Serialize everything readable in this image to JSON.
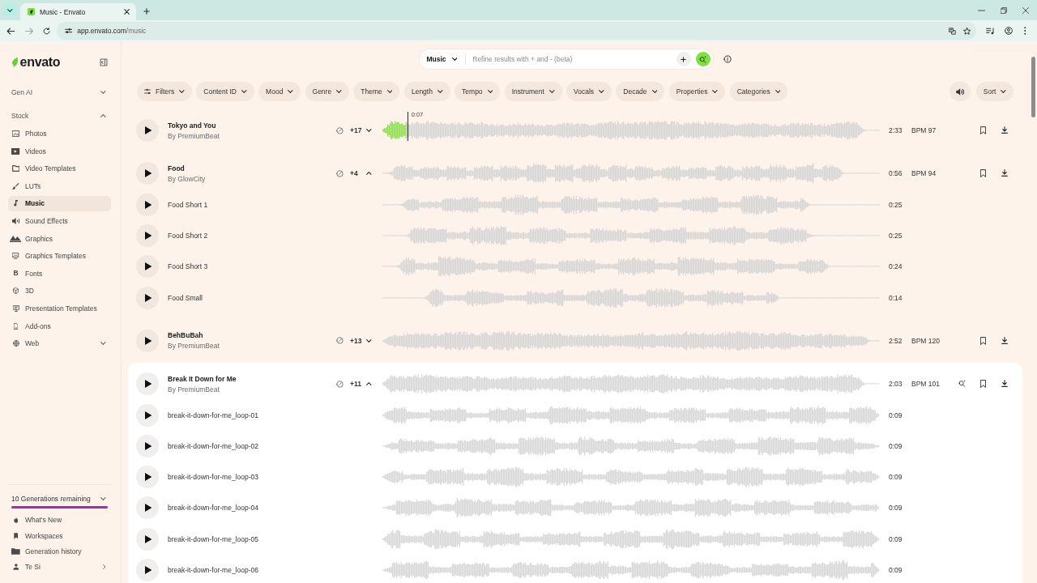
{
  "browser": {
    "tabs": [
      {
        "title": "Music - Envato",
        "selected": true
      }
    ],
    "url": {
      "host": "app.envato.com",
      "path": "/music"
    }
  },
  "sidebar": {
    "logo": "envato",
    "sections": [
      {
        "label": "Gen AI",
        "expanded": false
      },
      {
        "label": "Stock",
        "expanded": true,
        "items": [
          {
            "label": "Photos",
            "selected": false
          },
          {
            "label": "Videos",
            "selected": false
          },
          {
            "label": "Video Templates",
            "selected": false
          },
          {
            "label": "LUTs",
            "selected": false
          },
          {
            "label": "Music",
            "selected": true
          },
          {
            "label": "Sound Effects",
            "selected": false
          },
          {
            "label": "Graphics",
            "selected": false
          },
          {
            "label": "Graphics Templates",
            "selected": false
          },
          {
            "label": "Fonts",
            "glyph": "B",
            "selected": false
          },
          {
            "label": "3D",
            "selected": false
          },
          {
            "label": "Presentation Templates",
            "selected": false
          },
          {
            "label": "Add-ons",
            "selected": false
          },
          {
            "label": "Web",
            "selected": false,
            "expanded": false
          }
        ]
      }
    ],
    "generations": {
      "label": "10 Generations remaining",
      "level": 1,
      "expanded": false
    },
    "footer": [
      {
        "label": "What's New",
        "submenu": false
      },
      {
        "label": "Workspaces",
        "submenu": false
      },
      {
        "label": "Generation history",
        "submenu": false
      },
      {
        "label": "Te Si",
        "submenu": true
      }
    ]
  },
  "search": {
    "scope": "Music",
    "placeholder": "Refine results with + and - (beta)"
  },
  "filters": {
    "main": "Filters",
    "chips": [
      "Content ID",
      "Mood",
      "Genre",
      "Theme",
      "Length",
      "Tempo",
      "Instrument",
      "Vocals",
      "Decade",
      "Properties",
      "Categories"
    ],
    "sort": "Sort"
  },
  "tracks": [
    {
      "title": "Tokyo and You",
      "author": "By PremiumBeat",
      "versions_count": "+17",
      "expanded": false,
      "duration": "2:33",
      "bpm": "BPM 97",
      "hovered": false,
      "playback": {
        "level": 0.05,
        "time": "0:07"
      }
    },
    {
      "title": "Food",
      "author": "By GlowCity",
      "versions_count": "+4",
      "expanded": true,
      "duration": "0:56",
      "bpm": "BPM 94",
      "hovered": false,
      "versions": [
        {
          "title": "Food Short 1",
          "duration": "0:25"
        },
        {
          "title": "Food Short 2",
          "duration": "0:25"
        },
        {
          "title": "Food Short 3",
          "duration": "0:24"
        },
        {
          "title": "Food Small",
          "duration": "0:14"
        }
      ]
    },
    {
      "title": "BehBuBah",
      "author": "By PremiumBeat",
      "versions_count": "+13",
      "expanded": false,
      "duration": "2:52",
      "bpm": "BPM 120",
      "hovered": false
    },
    {
      "title": "Break It Down for Me",
      "author": "By PremiumBeat",
      "versions_count": "+11",
      "expanded": true,
      "duration": "2:03",
      "bpm": "BPM 101",
      "hovered": true,
      "versions": [
        {
          "title": "break-it-down-for-me_loop-01",
          "duration": "0:09"
        },
        {
          "title": "break-it-down-for-me_loop-02",
          "duration": "0:09"
        },
        {
          "title": "break-it-down-for-me_loop-03",
          "duration": "0:09"
        },
        {
          "title": "break-it-down-for-me_loop-04",
          "duration": "0:09"
        },
        {
          "title": "break-it-down-for-me_loop-05",
          "duration": "0:09"
        },
        {
          "title": "break-it-down-for-me_loop-06",
          "duration": "0:09"
        }
      ]
    }
  ]
}
